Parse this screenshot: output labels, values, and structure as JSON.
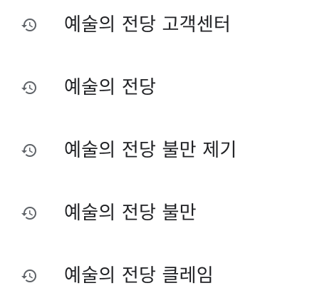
{
  "history": {
    "items": [
      {
        "icon": "history-icon",
        "text": "예술의 전당 고객센터"
      },
      {
        "icon": "history-icon",
        "text": "예술의 전당"
      },
      {
        "icon": "history-icon",
        "text": "예술의 전당 불만 제기"
      },
      {
        "icon": "history-icon",
        "text": "예술의 전당 불만"
      },
      {
        "icon": "history-icon",
        "text": "예술의 전당 클레임"
      }
    ]
  },
  "colors": {
    "text": "#202124",
    "icon": "#5f6368",
    "background": "#ffffff"
  }
}
